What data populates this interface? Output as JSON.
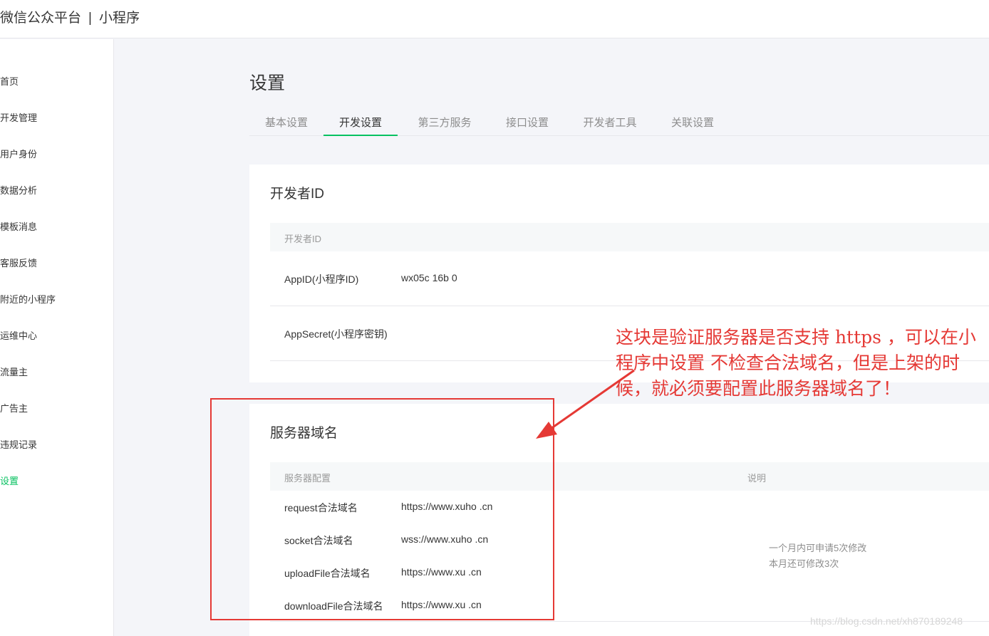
{
  "header": {
    "brand": "微信公众平台",
    "separator": "|",
    "product": "小程序"
  },
  "sidebar": {
    "items": [
      {
        "label": "首页"
      },
      {
        "label": "开发管理"
      },
      {
        "label": "用户身份"
      },
      {
        "label": "数据分析"
      },
      {
        "label": "模板消息"
      },
      {
        "label": "客服反馈"
      },
      {
        "label": "附近的小程序"
      },
      {
        "label": "运维中心"
      },
      {
        "label": "流量主"
      },
      {
        "label": "广告主"
      },
      {
        "label": "违规记录"
      },
      {
        "label": "设置",
        "active": true
      }
    ]
  },
  "main": {
    "title": "设置",
    "tabs": [
      {
        "label": "基本设置"
      },
      {
        "label": "开发设置",
        "active": true
      },
      {
        "label": "第三方服务"
      },
      {
        "label": "接口设置"
      },
      {
        "label": "开发者工具"
      },
      {
        "label": "关联设置"
      }
    ],
    "developer_card": {
      "title": "开发者ID",
      "header": "开发者ID",
      "appid_label": "AppID(小程序ID)",
      "appid_value": "wx05c 16b 0",
      "secret_label": "AppSecret(小程序密钥)"
    },
    "server_card": {
      "title": "服务器域名",
      "col_config": "服务器配置",
      "col_note": "说明",
      "rows": [
        {
          "label": "request合法域名",
          "value": "https://www.xuho .cn"
        },
        {
          "label": "socket合法域名",
          "value": "wss://www.xuho .cn"
        },
        {
          "label": "uploadFile合法域名",
          "value": "https://www.xu .cn"
        },
        {
          "label": "downloadFile合法域名",
          "value": "https://www.xu .cn"
        }
      ],
      "note_line1": "一个月内可申请5次修改",
      "note_line2": "本月还可修改3次"
    }
  },
  "annotation": {
    "text": "这块是验证服务器是否支持 https ，可以在小程序中设置 不检查合法域名，但是上架的时候，就必须要配置此服务器域名了！",
    "color": "#e53935"
  },
  "watermark": "https://blog.csdn.net/xh870189248",
  "colors": {
    "accent": "#07c160",
    "annotation": "#e53935"
  }
}
